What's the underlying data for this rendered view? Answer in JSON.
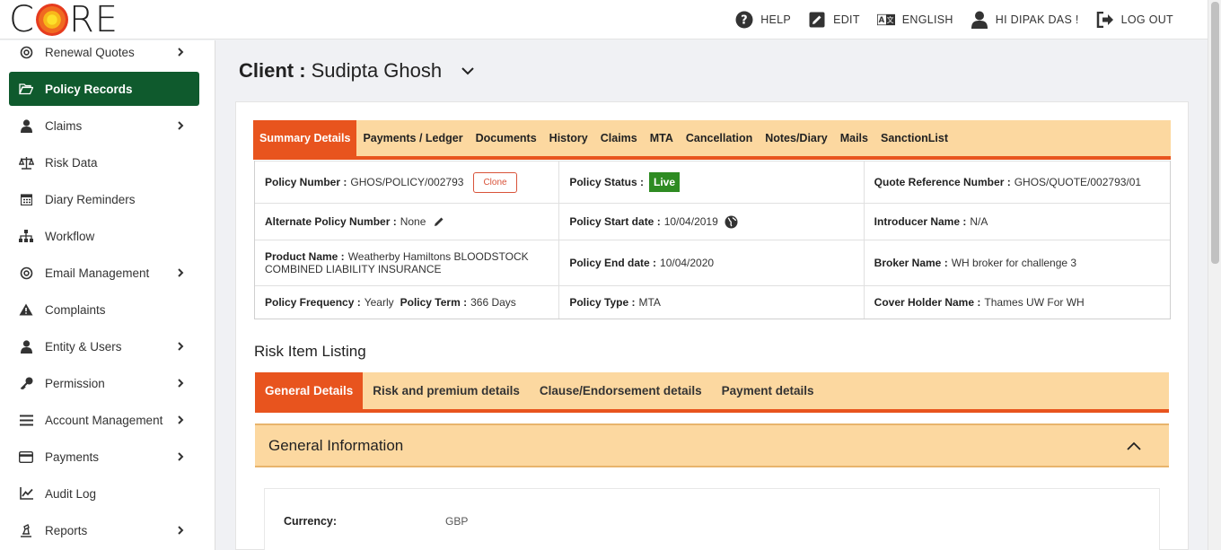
{
  "header": {
    "logo": "CORE",
    "nav": [
      {
        "label": "HELP"
      },
      {
        "label": "EDIT"
      },
      {
        "label": "ENGLISH"
      },
      {
        "label": "HI DIPAK DAS !"
      },
      {
        "label": "LOG OUT"
      }
    ]
  },
  "sidebar": {
    "items": [
      {
        "label": "Renewal Quotes"
      },
      {
        "label": "Policy Records"
      },
      {
        "label": "Claims"
      },
      {
        "label": "Risk Data"
      },
      {
        "label": "Diary Reminders"
      },
      {
        "label": "Workflow"
      },
      {
        "label": "Email Management"
      },
      {
        "label": "Complaints"
      },
      {
        "label": "Entity & Users"
      },
      {
        "label": "Permission"
      },
      {
        "label": "Account Management"
      },
      {
        "label": "Payments"
      },
      {
        "label": "Audit Log"
      },
      {
        "label": "Reports"
      }
    ]
  },
  "client": {
    "label": "Client :",
    "name": "Sudipta Ghosh"
  },
  "tabs": [
    {
      "label": "Summary Details"
    },
    {
      "label": "Payments / Ledger"
    },
    {
      "label": "Documents"
    },
    {
      "label": "History"
    },
    {
      "label": "Claims"
    },
    {
      "label": "MTA"
    },
    {
      "label": "Cancellation"
    },
    {
      "label": "Notes/Diary"
    },
    {
      "label": "Mails"
    },
    {
      "label": "SanctionList"
    }
  ],
  "summary": {
    "policy_number_label": "Policy Number :",
    "policy_number": "GHOS/POLICY/002793",
    "clone_label": "Clone",
    "policy_status_label": "Policy Status :",
    "policy_status": "Live",
    "quote_ref_label": "Quote Reference Number :",
    "quote_ref": "GHOS/QUOTE/002793/01",
    "alt_policy_label": "Alternate Policy Number :",
    "alt_policy": "None",
    "start_date_label": "Policy Start date :",
    "start_date": "10/04/2019",
    "introducer_label": "Introducer Name :",
    "introducer": "N/A",
    "product_label": "Product Name :",
    "product": "Weatherby Hamiltons BLOODSTOCK COMBINED LIABILITY INSURANCE",
    "end_date_label": "Policy End date :",
    "end_date": "10/04/2020",
    "broker_label": "Broker Name :",
    "broker": "WH broker for challenge 3",
    "frequency_label": "Policy Frequency :",
    "frequency": "Yearly",
    "term_label": "Policy Term :",
    "term": "366 Days",
    "policy_type_label": "Policy Type :",
    "policy_type": "MTA",
    "cover_holder_label": "Cover Holder Name :",
    "cover_holder": "Thames UW For WH"
  },
  "risk": {
    "title": "Risk Item Listing",
    "tabs": [
      {
        "label": "General Details"
      },
      {
        "label": "Risk and premium details"
      },
      {
        "label": "Clause/Endorsement details"
      },
      {
        "label": "Payment details"
      }
    ],
    "section_title": "General Information",
    "currency_label": "Currency:",
    "currency": "GBP"
  },
  "colors": {
    "accent": "#e8541e",
    "tab_bg": "#fcd8a0",
    "active_sidebar": "#0f5a2d",
    "live_badge": "#2e8b22"
  }
}
